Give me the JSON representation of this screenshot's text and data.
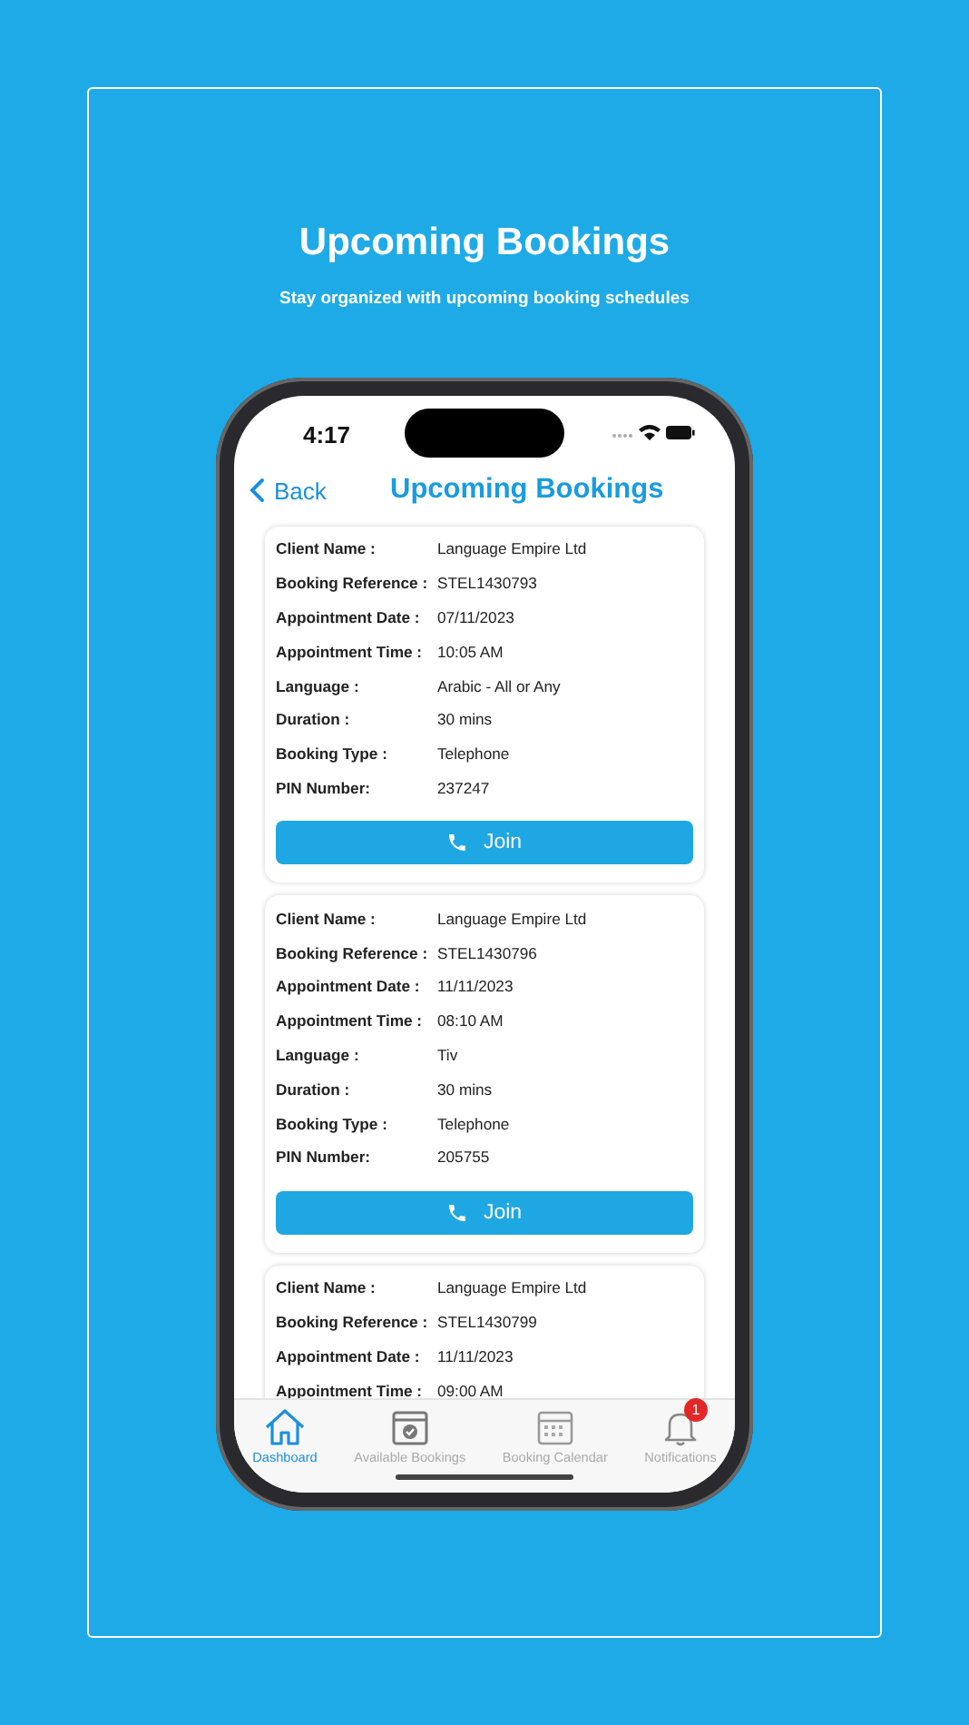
{
  "heading": "Upcoming Bookings",
  "subheading": "Stay organized with upcoming booking schedules",
  "status_bar": {
    "time": "4:17"
  },
  "nav": {
    "back": "Back",
    "title": "Upcoming Bookings"
  },
  "bookings": [
    {
      "fields": [
        {
          "label": "Client Name :",
          "value": "Language Empire Ltd"
        },
        {
          "label": "Booking Reference :",
          "value": "STEL1430793"
        },
        {
          "label": "Appointment Date :",
          "value": "07/11/2023"
        },
        {
          "label": "Appointment Time :",
          "value": "10:05 AM"
        },
        {
          "label": "Language :",
          "value": "Arabic - All or Any"
        },
        {
          "label": "Duration :",
          "value": "30 mins"
        },
        {
          "label": "Booking Type :",
          "value": "Telephone"
        },
        {
          "label": "PIN Number:",
          "value": "237247"
        }
      ],
      "join": "Join"
    },
    {
      "fields": [
        {
          "label": "Client Name :",
          "value": "Language Empire Ltd"
        },
        {
          "label": "Booking Reference :",
          "value": "STEL1430796"
        },
        {
          "label": "Appointment Date :",
          "value": "11/11/2023"
        },
        {
          "label": "Appointment Time :",
          "value": "08:10 AM"
        },
        {
          "label": "Language :",
          "value": "Tiv"
        },
        {
          "label": "Duration :",
          "value": "30 mins"
        },
        {
          "label": "Booking Type :",
          "value": "Telephone"
        },
        {
          "label": "PIN Number:",
          "value": "205755"
        }
      ],
      "join": "Join"
    },
    {
      "fields": [
        {
          "label": "Client Name :",
          "value": "Language Empire Ltd"
        },
        {
          "label": "Booking Reference :",
          "value": "STEL1430799"
        },
        {
          "label": "Appointment Date :",
          "value": "11/11/2023"
        },
        {
          "label": "Appointment Time :",
          "value": "09:00 AM"
        }
      ]
    }
  ],
  "tabs": [
    {
      "kind": "home",
      "label": "Dashboard",
      "selected": true
    },
    {
      "kind": "calendar-check",
      "label": "Available Bookings",
      "selected": false
    },
    {
      "kind": "calendar-grid",
      "label": "Booking Calendar",
      "selected": false
    },
    {
      "kind": "bell",
      "label": "Notifications",
      "selected": false,
      "badge": "1"
    }
  ]
}
